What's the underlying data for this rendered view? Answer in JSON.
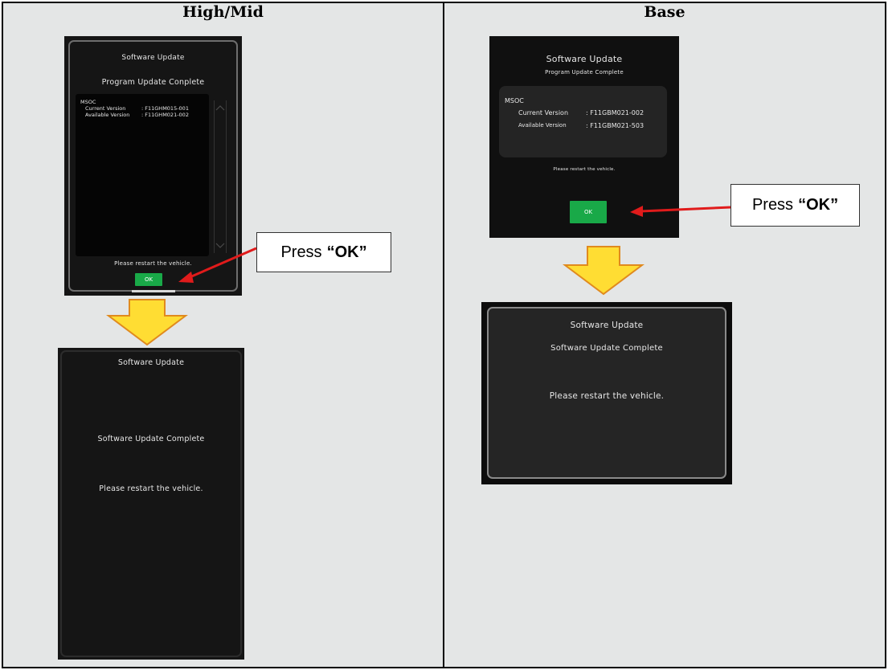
{
  "columns": {
    "left_title": "High/Mid",
    "right_title": "Base"
  },
  "high_mid": {
    "screen1": {
      "title": "Software Update",
      "subtitle": "Program Update Conplete",
      "module": "MSOC",
      "current_version_label": "Current Version",
      "current_version_value": ": F11GHM015-001",
      "available_version_label": "Available Version",
      "available_version_value": ": F11GHM021-002",
      "restart_msg": "Please restart the vehicle.",
      "ok_label": "OK"
    },
    "callout": {
      "prefix": "Press",
      "emph": "“OK”"
    },
    "screen2": {
      "title": "Software Update",
      "complete_msg": "Software Update Complete",
      "restart_msg": "Please restart the vehicle."
    }
  },
  "base": {
    "screen1": {
      "title": "Software Update",
      "subtitle": "Program Update Complete",
      "module": "MSOC",
      "current_version_label": "Current Version",
      "current_version_value": ": F11GBM021-002",
      "available_version_label": "Available Version",
      "available_version_value": ": F11GBM021-503",
      "restart_msg": "Please restart the vehicle.",
      "ok_label": "OK"
    },
    "callout": {
      "prefix": "Press",
      "emph": "“OK”"
    },
    "screen2": {
      "title": "Software Update",
      "complete_msg": "Software Update Complete",
      "restart_msg": "Please restart the vehicle."
    }
  },
  "colors": {
    "background": "#e4e6e6",
    "screen": "#151515",
    "ok_button": "#19a948",
    "arrow_fill": "#ffdd33",
    "arrow_stroke": "#e08a1e",
    "pointer": "#e01b1b"
  }
}
